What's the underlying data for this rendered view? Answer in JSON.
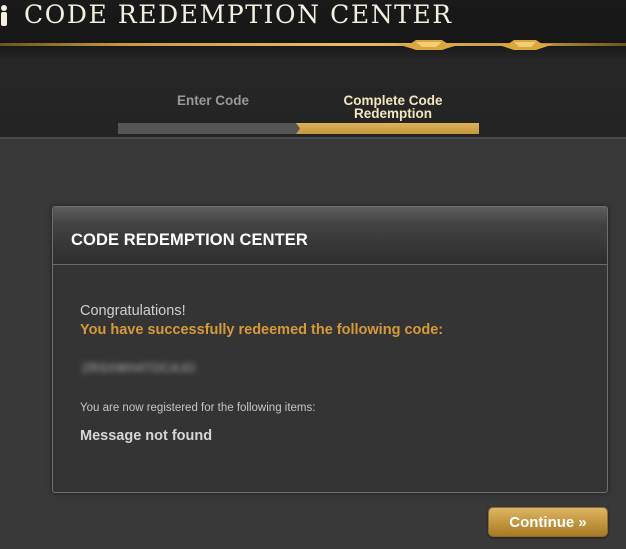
{
  "header": {
    "title": "CODE REDEMPTION CENTER"
  },
  "steps": [
    {
      "label": "Enter Code",
      "state": "completed"
    },
    {
      "label": "Complete Code Redemption",
      "label_line1": "Complete Code",
      "label_line2": "Redemption",
      "state": "current"
    }
  ],
  "panel": {
    "title": "CODE REDEMPTION CENTER",
    "congrats": "Congratulations!",
    "success_message": "You have successfully redeemed the following code:",
    "redeemed_code": "ZRSXWH4TOCAJO",
    "registered_text": "You are now registered for the following items:",
    "items_message": "Message not found"
  },
  "actions": {
    "continue_label": "Continue »"
  },
  "colors": {
    "accent_gold": "#c89a3d",
    "success_text": "#d69a3a",
    "background": "#393939"
  }
}
